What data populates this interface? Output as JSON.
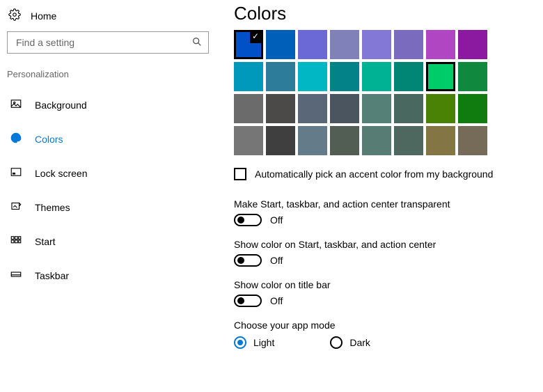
{
  "sidebar": {
    "home_label": "Home",
    "search_placeholder": "Find a setting",
    "group_title": "Personalization",
    "items": [
      {
        "label": "Background"
      },
      {
        "label": "Colors"
      },
      {
        "label": "Lock screen"
      },
      {
        "label": "Themes"
      },
      {
        "label": "Start"
      },
      {
        "label": "Taskbar"
      }
    ]
  },
  "main": {
    "title": "Colors",
    "auto_pick_label": "Automatically pick an accent color from my background",
    "toggles": [
      {
        "label": "Make Start, taskbar, and action center transparent",
        "value": "Off"
      },
      {
        "label": "Show color on Start, taskbar, and action center",
        "value": "Off"
      },
      {
        "label": "Show color on title bar",
        "value": "Off"
      }
    ],
    "app_mode": {
      "label": "Choose your app mode",
      "options": [
        "Light",
        "Dark"
      ],
      "selected": "Light"
    },
    "color_rows": [
      [
        "#0050c7",
        "#005fb8",
        "#6b69d6",
        "#8081b9",
        "#8378d6",
        "#7b6bbf",
        "#b146c2",
        "#8c1aa0"
      ],
      [
        "#0099bc",
        "#2d7d9a",
        "#00b7c3",
        "#038387",
        "#00b294",
        "#018574",
        "#00cc6a",
        "#10893e"
      ],
      [
        "#6b6b6b",
        "#4c4a48",
        "#5a6778",
        "#4a5560",
        "#548078",
        "#486860",
        "#498205",
        "#107c10"
      ],
      [
        "#767676",
        "#3f3f3f",
        "#647c8a",
        "#525e54",
        "#567c73",
        "#4e685f",
        "#847545",
        "#766b59"
      ]
    ],
    "selected_color_index": [
      0,
      0
    ],
    "current_color_index": [
      1,
      6
    ]
  }
}
